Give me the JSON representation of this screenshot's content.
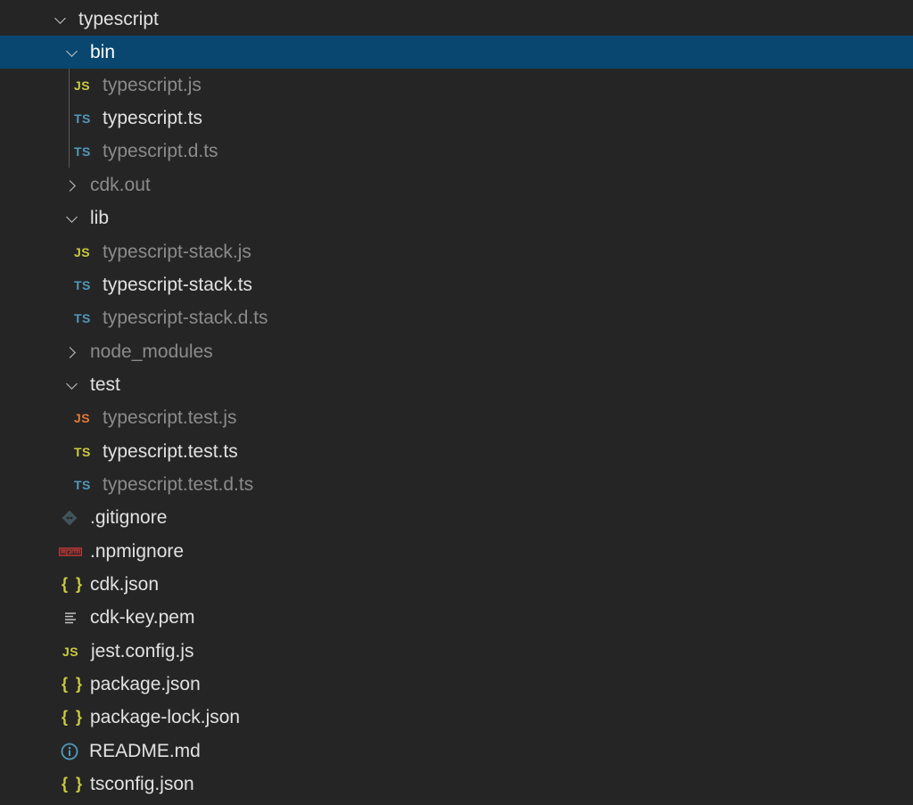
{
  "explorer": {
    "root": {
      "label": "typescript"
    },
    "bin": {
      "label": "bin",
      "files": [
        "typescript.js",
        "typescript.ts",
        "typescript.d.ts"
      ],
      "icon_texts": [
        "JS",
        "TS",
        "TS"
      ]
    },
    "cdk_out": {
      "label": "cdk.out"
    },
    "lib": {
      "label": "lib",
      "files": [
        "typescript-stack.js",
        "typescript-stack.ts",
        "typescript-stack.d.ts"
      ],
      "icon_texts": [
        "JS",
        "TS",
        "TS"
      ]
    },
    "node_modules": {
      "label": "node_modules"
    },
    "test": {
      "label": "test",
      "files": [
        "typescript.test.js",
        "typescript.test.ts",
        "typescript.test.d.ts"
      ],
      "icon_texts": [
        "JS",
        "TS",
        "TS"
      ]
    },
    "root_files": [
      {
        "label": ".gitignore",
        "icon": "git-icon"
      },
      {
        "label": ".npmignore",
        "icon": "npm-icon"
      },
      {
        "label": "cdk.json",
        "icon": "json-icon",
        "icon_text": "{ }"
      },
      {
        "label": "cdk-key.pem",
        "icon": "text-file-icon"
      },
      {
        "label": "jest.config.js",
        "icon": "js-icon",
        "icon_text": "JS"
      },
      {
        "label": "package.json",
        "icon": "json-icon",
        "icon_text": "{ }"
      },
      {
        "label": "package-lock.json",
        "icon": "json-icon",
        "icon_text": "{ }"
      },
      {
        "label": "README.md",
        "icon": "info-icon"
      },
      {
        "label": "tsconfig.json",
        "icon": "json-icon",
        "icon_text": "{ }"
      }
    ]
  },
  "colors": {
    "background": "#252526",
    "selection": "#094771",
    "js_yellow": "#cbcb41",
    "js_orange": "#e37933",
    "ts_blue": "#519aba",
    "git_gray": "#41535b",
    "npm_red": "#cb3837"
  }
}
